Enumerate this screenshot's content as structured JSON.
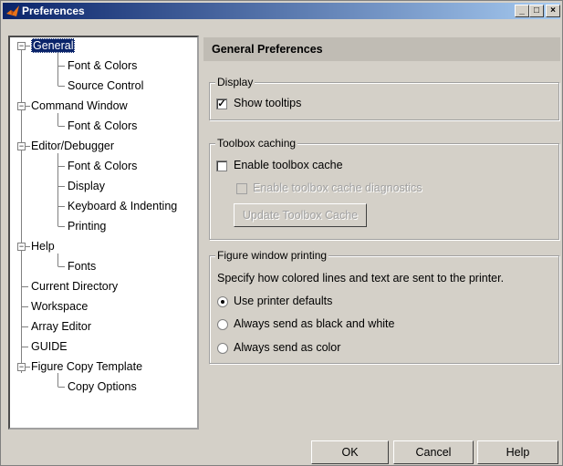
{
  "window": {
    "title": "Preferences",
    "minimize": "_",
    "maximize": "□",
    "close": "×"
  },
  "tree": {
    "items": [
      {
        "label": "General",
        "selected": true
      },
      {
        "label": "Font & Colors"
      },
      {
        "label": "Source Control"
      },
      {
        "label": "Command Window"
      },
      {
        "label": "Font & Colors"
      },
      {
        "label": "Editor/Debugger"
      },
      {
        "label": "Font & Colors"
      },
      {
        "label": "Display"
      },
      {
        "label": "Keyboard & Indenting"
      },
      {
        "label": "Printing"
      },
      {
        "label": "Help"
      },
      {
        "label": "Fonts"
      },
      {
        "label": "Current Directory"
      },
      {
        "label": "Workspace"
      },
      {
        "label": "Array Editor"
      },
      {
        "label": "GUIDE"
      },
      {
        "label": "Figure Copy Template"
      },
      {
        "label": "Copy Options"
      }
    ]
  },
  "panel": {
    "header": "General Preferences",
    "display": {
      "label": "Display",
      "show_tooltips": "Show tooltips",
      "show_tooltips_checked": true
    },
    "toolbox": {
      "label": "Toolbox caching",
      "enable_cache": "Enable toolbox cache",
      "enable_diag": "Enable toolbox cache diagnostics",
      "update_button": "Update Toolbox Cache"
    },
    "printing": {
      "label": "Figure window printing",
      "description": "Specify how colored lines and text are sent to the printer.",
      "options": [
        "Use printer defaults",
        "Always send as black and white",
        "Always send as color"
      ],
      "selected": 0
    }
  },
  "buttons": {
    "ok": "OK",
    "cancel": "Cancel",
    "help": "Help"
  },
  "colors": {
    "selection": "#0a246a",
    "title_start": "#0a246a",
    "title_end": "#a6caf0"
  }
}
